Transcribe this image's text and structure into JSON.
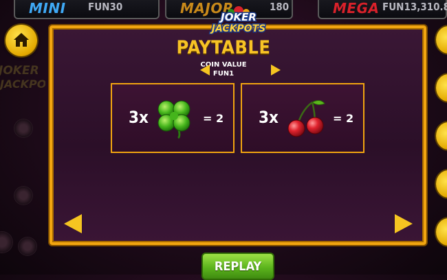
{
  "jackpots": [
    {
      "name": "MINI",
      "value": "FUN30",
      "color": "#3fa9f5"
    },
    {
      "name": "MAJOR",
      "value": "180",
      "color": "#c98a1a"
    },
    {
      "name": "MEGA",
      "value": "FUN13,310.8",
      "color": "#d9212a"
    }
  ],
  "logo": {
    "line1": "JOKER",
    "line2": "JACKPOTS"
  },
  "paytable": {
    "title": "PAYTABLE",
    "coin_value_label": "COIN VALUE",
    "coin_value": "FUN1",
    "items": [
      {
        "count": "3x",
        "symbol": "clover-icon",
        "payout": "= 2"
      },
      {
        "count": "3x",
        "symbol": "cherry-icon",
        "payout": "= 2"
      }
    ]
  },
  "replay_label": "REPLAY",
  "colors": {
    "accent": "#f2a510",
    "button_green": "#5cb51d",
    "panel": "#2b0f28"
  }
}
